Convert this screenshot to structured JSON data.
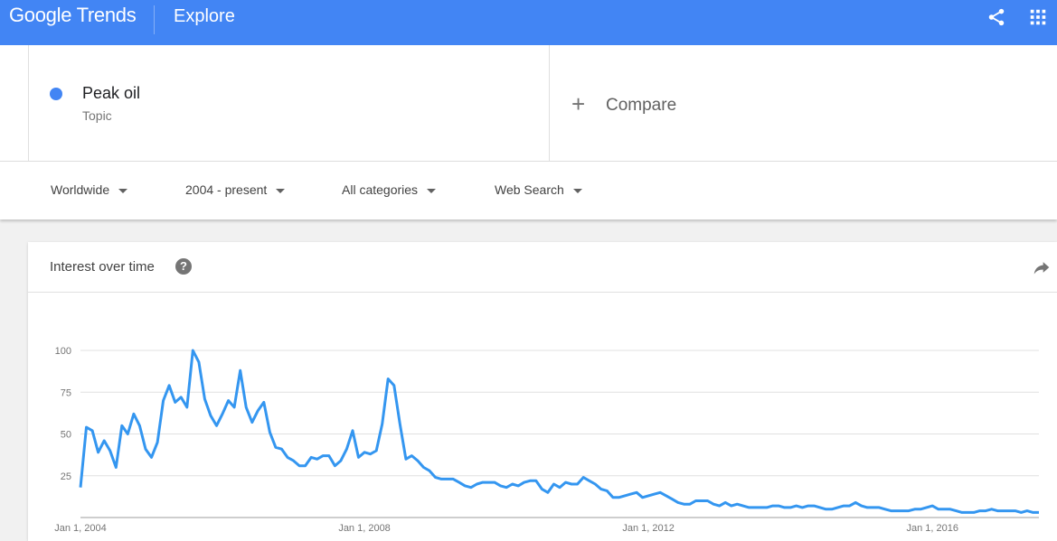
{
  "header": {
    "logo_google": "Google",
    "logo_trends": "Trends",
    "title": "Explore",
    "share_icon": "share-icon",
    "apps_icon": "apps-grid-icon"
  },
  "terms": {
    "term": {
      "name": "Peak oil",
      "type": "Topic",
      "color": "#4285f4"
    },
    "compare_label": "Compare"
  },
  "filters": {
    "region": "Worldwide",
    "time": "2004 - present",
    "category": "All categories",
    "property": "Web Search"
  },
  "card": {
    "title": "Interest over time",
    "help_icon": "help-icon",
    "share_icon": "share-arrow-icon"
  },
  "chart_data": {
    "type": "line",
    "title": "Interest over time",
    "ylim": [
      0,
      100
    ],
    "y_ticks": [
      25,
      50,
      75,
      100
    ],
    "x_ticks": [
      "Jan 1, 2004",
      "Jan 1, 2008",
      "Jan 1, 2012",
      "Jan 1, 2016"
    ],
    "grid": true,
    "color": "#3496f0",
    "x_start_year": 2004,
    "series": [
      {
        "values": [
          18,
          54,
          52,
          39,
          46,
          40,
          30,
          55,
          50,
          62,
          55,
          41,
          36,
          45,
          70,
          79,
          69,
          72,
          66,
          100,
          93,
          71,
          61,
          55,
          62,
          70,
          66,
          88,
          66,
          57,
          64,
          69,
          51,
          42,
          41,
          36,
          34,
          31,
          31,
          36,
          35,
          37,
          37,
          31,
          34,
          41,
          52,
          36,
          39,
          38,
          40,
          56,
          83,
          79,
          56,
          35,
          37,
          34,
          30,
          28,
          24,
          23,
          23,
          23,
          21,
          19,
          18,
          20,
          21,
          21,
          21,
          19,
          18,
          20,
          19,
          21,
          22,
          22,
          17,
          15,
          20,
          18,
          21,
          20,
          20,
          24,
          22,
          20,
          17,
          16,
          12,
          12,
          13,
          14,
          15,
          12,
          13,
          14,
          15,
          13,
          11,
          9,
          8,
          8,
          10,
          10,
          10,
          8,
          7,
          9,
          7,
          8,
          7,
          6,
          6,
          6,
          6,
          7,
          7,
          6,
          6,
          7,
          6,
          7,
          7,
          6,
          5,
          5,
          6,
          7,
          7,
          9,
          7,
          6,
          6,
          6,
          5,
          4,
          4,
          4,
          4,
          5,
          5,
          6,
          7,
          5,
          5,
          5,
          4,
          3,
          3,
          3,
          4,
          4,
          5,
          4,
          4,
          4,
          4,
          3,
          4,
          3,
          3
        ]
      }
    ]
  }
}
